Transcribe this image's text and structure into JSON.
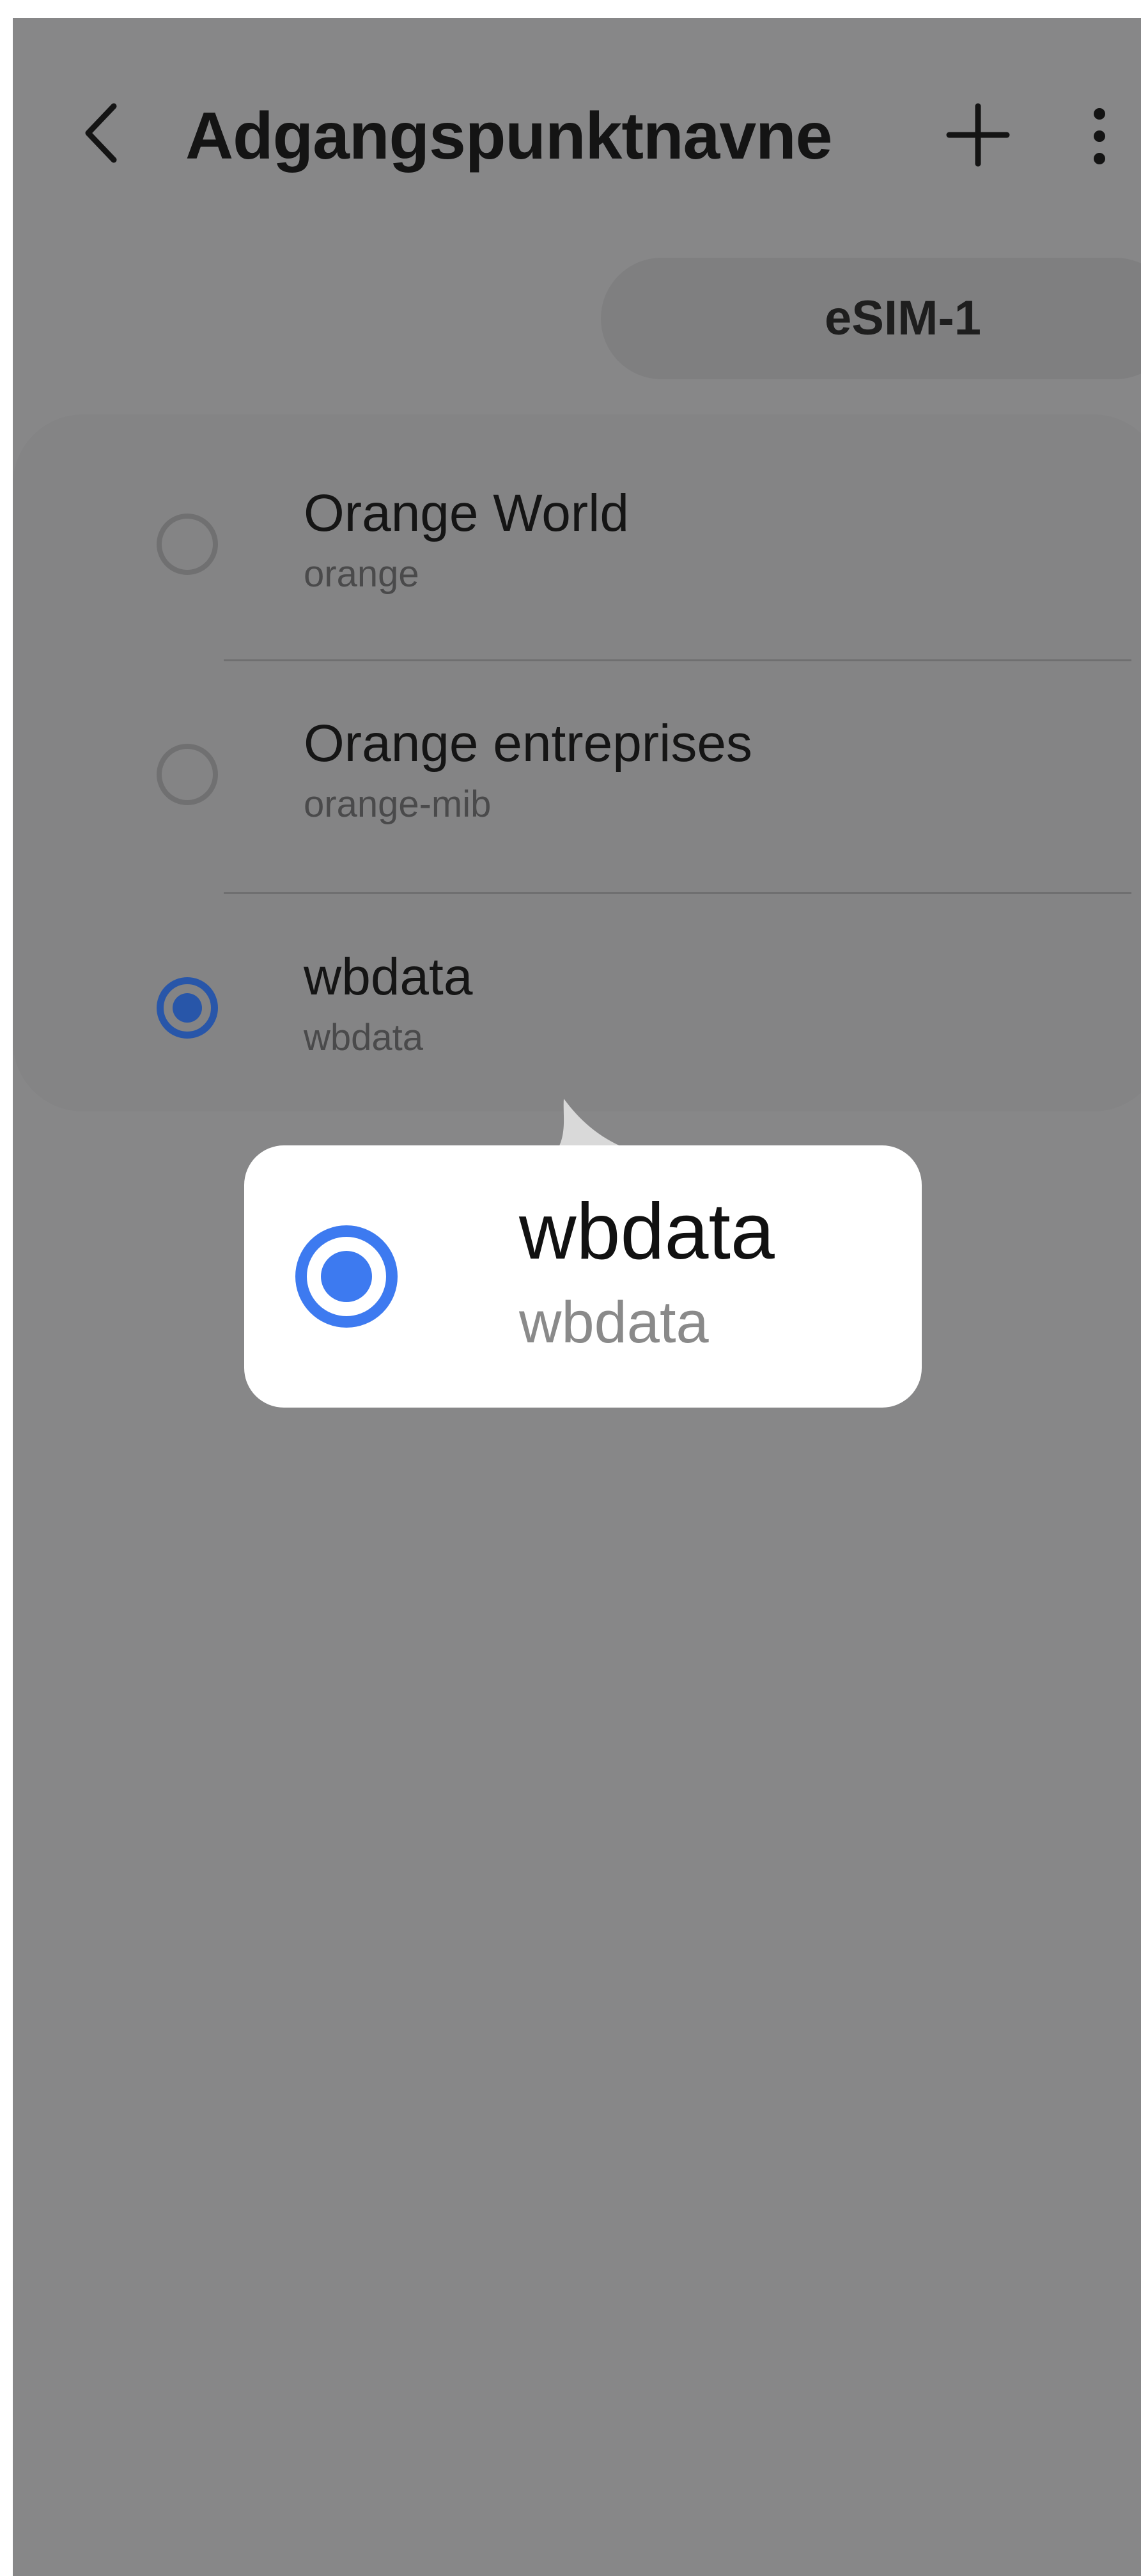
{
  "header": {
    "title": "Adgangspunktnavne",
    "back_icon": "chevron-left-icon",
    "add_icon": "plus-icon",
    "more_icon": "more-vertical-icon"
  },
  "sim_tabs": [
    {
      "label": "eSIM-1",
      "selected": true
    }
  ],
  "apn_list": [
    {
      "name": "Orange World",
      "apn": "orange",
      "selected": false
    },
    {
      "name": "Orange entreprises",
      "apn": "orange-mib",
      "selected": false
    },
    {
      "name": "wbdata",
      "apn": "wbdata",
      "selected": true
    }
  ],
  "callout": {
    "name": "wbdata",
    "apn": "wbdata",
    "selected": true
  },
  "colors": {
    "overlay_background": "#878788",
    "selected_radio": "#2856a9",
    "callout_radio": "#3d7af0",
    "callout_background": "#ffffff"
  }
}
